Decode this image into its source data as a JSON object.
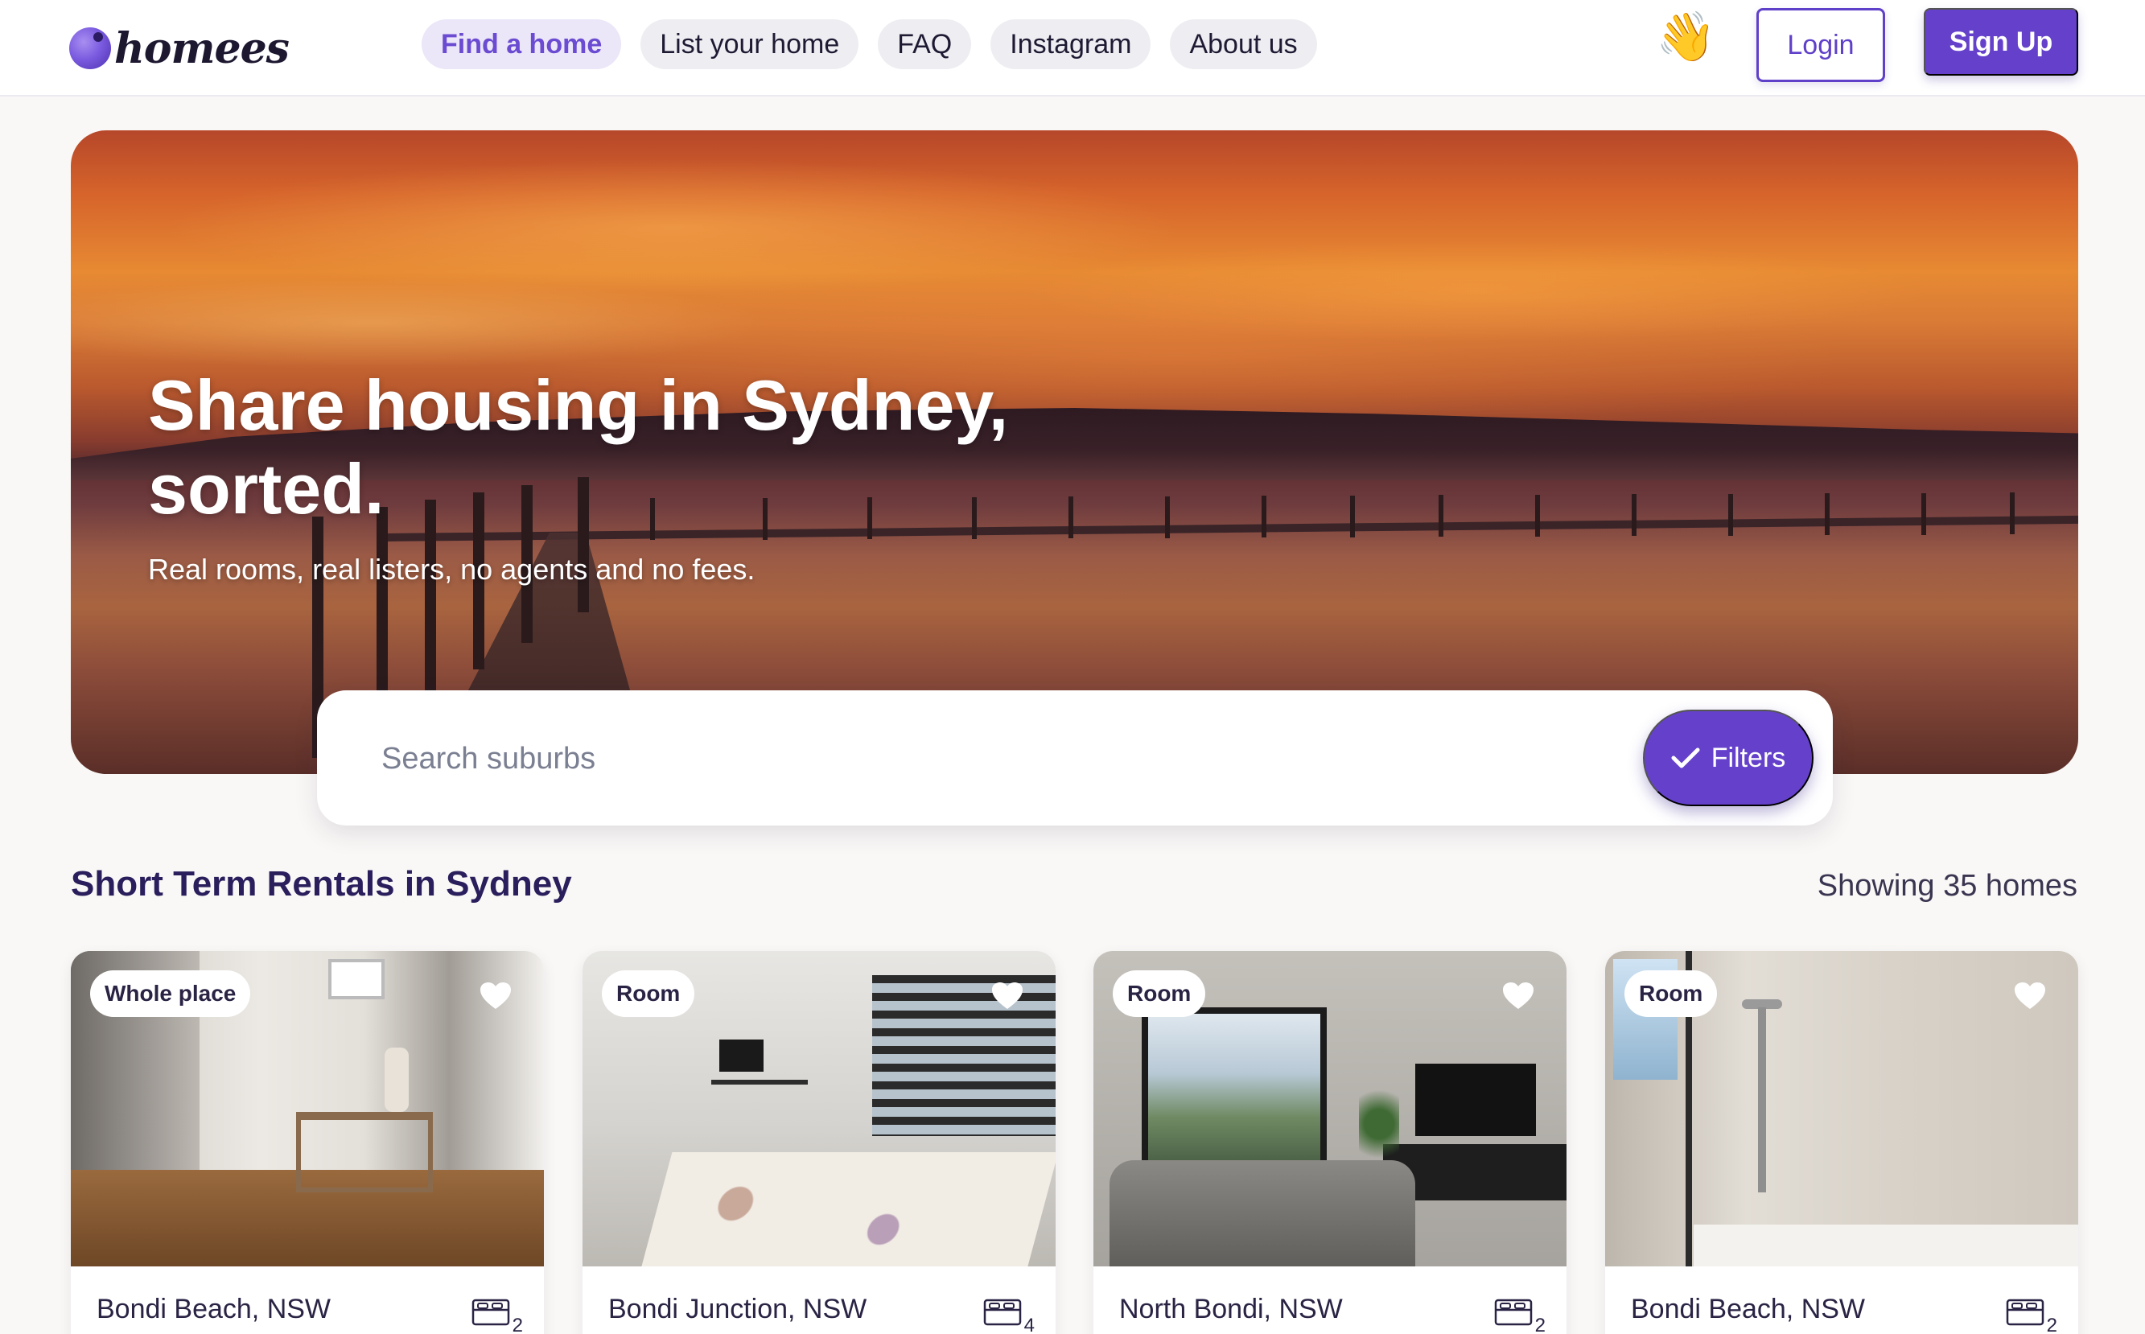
{
  "brand": {
    "name": "homees",
    "accent": "#6541cb",
    "accent_light": "#ebe6f8"
  },
  "nav": {
    "items": [
      {
        "label": "Find a home",
        "active": true
      },
      {
        "label": "List your home",
        "active": false
      },
      {
        "label": "FAQ",
        "active": false
      },
      {
        "label": "Instagram",
        "active": false
      },
      {
        "label": "About us",
        "active": false
      }
    ],
    "wave_emoji": "👋",
    "login_label": "Login",
    "signup_label": "Sign Up"
  },
  "hero": {
    "title_line1": "Share housing in Sydney,",
    "title_line2": "sorted.",
    "subtitle": "Real rooms, real listers, no agents and no fees."
  },
  "search": {
    "placeholder": "Search suburbs",
    "value": "",
    "filters_label": "Filters",
    "filters_icon": "check-icon"
  },
  "listings": {
    "title": "Short Term Rentals in Sydney",
    "count_text": "Showing 35 homes",
    "cards": [
      {
        "type": "Whole place",
        "location": "Bondi Beach, NSW",
        "beds": "2",
        "favorite_icon": "heart-icon"
      },
      {
        "type": "Room",
        "location": "Bondi Junction, NSW",
        "beds": "4",
        "favorite_icon": "heart-icon"
      },
      {
        "type": "Room",
        "location": "North Bondi, NSW",
        "beds": "2",
        "favorite_icon": "heart-icon"
      },
      {
        "type": "Room",
        "location": "Bondi Beach, NSW",
        "beds": "2",
        "favorite_icon": "heart-icon"
      }
    ]
  }
}
